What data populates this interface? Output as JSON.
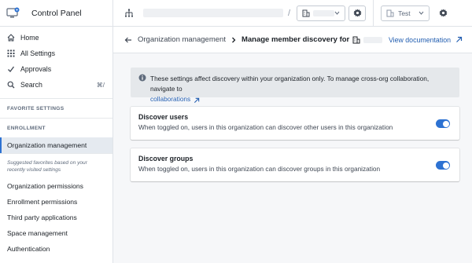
{
  "app": {
    "title": "Control Panel"
  },
  "topbar": {
    "project_selector_label": "",
    "env_selector_label": "Test"
  },
  "sidebar": {
    "nav": [
      {
        "label": "Home",
        "icon": "home-icon"
      },
      {
        "label": "All Settings",
        "icon": "grid-icon"
      },
      {
        "label": "Approvals",
        "icon": "check-icon"
      },
      {
        "label": "Search",
        "icon": "search-icon",
        "shortcut": "⌘/"
      }
    ],
    "favorites_header": "FAVORITE SETTINGS",
    "enrollment_header": "ENROLLMENT",
    "active_item": "Organization management",
    "suggest_note": "Suggested favorites based on your recently visited settings",
    "links": [
      "Organization permissions",
      "Enrollment permissions",
      "Third party applications",
      "Space management",
      "Authentication"
    ]
  },
  "header": {
    "breadcrumb": "Organization management",
    "title": "Manage member discovery for",
    "doc_link": "View documentation"
  },
  "callout": {
    "text": "These settings affect discovery within your organization only. To manage cross-org collaboration, navigate to",
    "link": "collaborations"
  },
  "settings": [
    {
      "title": "Discover users",
      "desc": "When toggled on, users in this organization can discover other users in this organization",
      "enabled": true
    },
    {
      "title": "Discover groups",
      "desc": "When toggled on, users in this organization can discover groups in this organization",
      "enabled": true
    }
  ],
  "colors": {
    "accent": "#2d72d2",
    "link": "#215db0",
    "callout_bg": "#e5e8eb"
  }
}
